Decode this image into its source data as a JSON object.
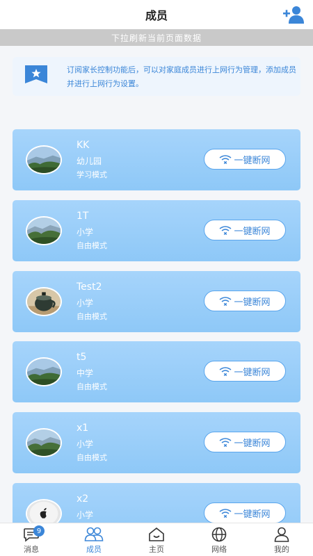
{
  "header": {
    "title": "成员"
  },
  "refresh_hint": "下拉刷新当前页面数据",
  "notice": {
    "text": "订阅家长控制功能后，可以对家庭成员进行上网行为管理，添加成员并进行上网行为设置。"
  },
  "members": [
    {
      "name": "KK",
      "school": "幼儿园",
      "mode": "学习模式",
      "action": "一键断网",
      "avatar": "landscape"
    },
    {
      "name": "1T",
      "school": "小学",
      "mode": "自由模式",
      "action": "一键断网",
      "avatar": "landscape"
    },
    {
      "name": "Test2",
      "school": "小学",
      "mode": "自由模式",
      "action": "一键断网",
      "avatar": "cup"
    },
    {
      "name": "t5",
      "school": "中学",
      "mode": "自由模式",
      "action": "一键断网",
      "avatar": "landscape"
    },
    {
      "name": "x1",
      "school": "小学",
      "mode": "自由模式",
      "action": "一键断网",
      "avatar": "landscape"
    },
    {
      "name": "x2",
      "school": "小学",
      "mode": "",
      "action": "一键断网",
      "avatar": "apple"
    }
  ],
  "tabs": [
    {
      "label": "消息",
      "icon": "message-icon",
      "badge": "9"
    },
    {
      "label": "成员",
      "icon": "members-icon",
      "active": true
    },
    {
      "label": "主页",
      "icon": "home-icon"
    },
    {
      "label": "网络",
      "icon": "globe-icon"
    },
    {
      "label": "我的",
      "icon": "profile-icon"
    }
  ],
  "colors": {
    "accent": "#3b86d8",
    "card": "#9ccdf9"
  }
}
